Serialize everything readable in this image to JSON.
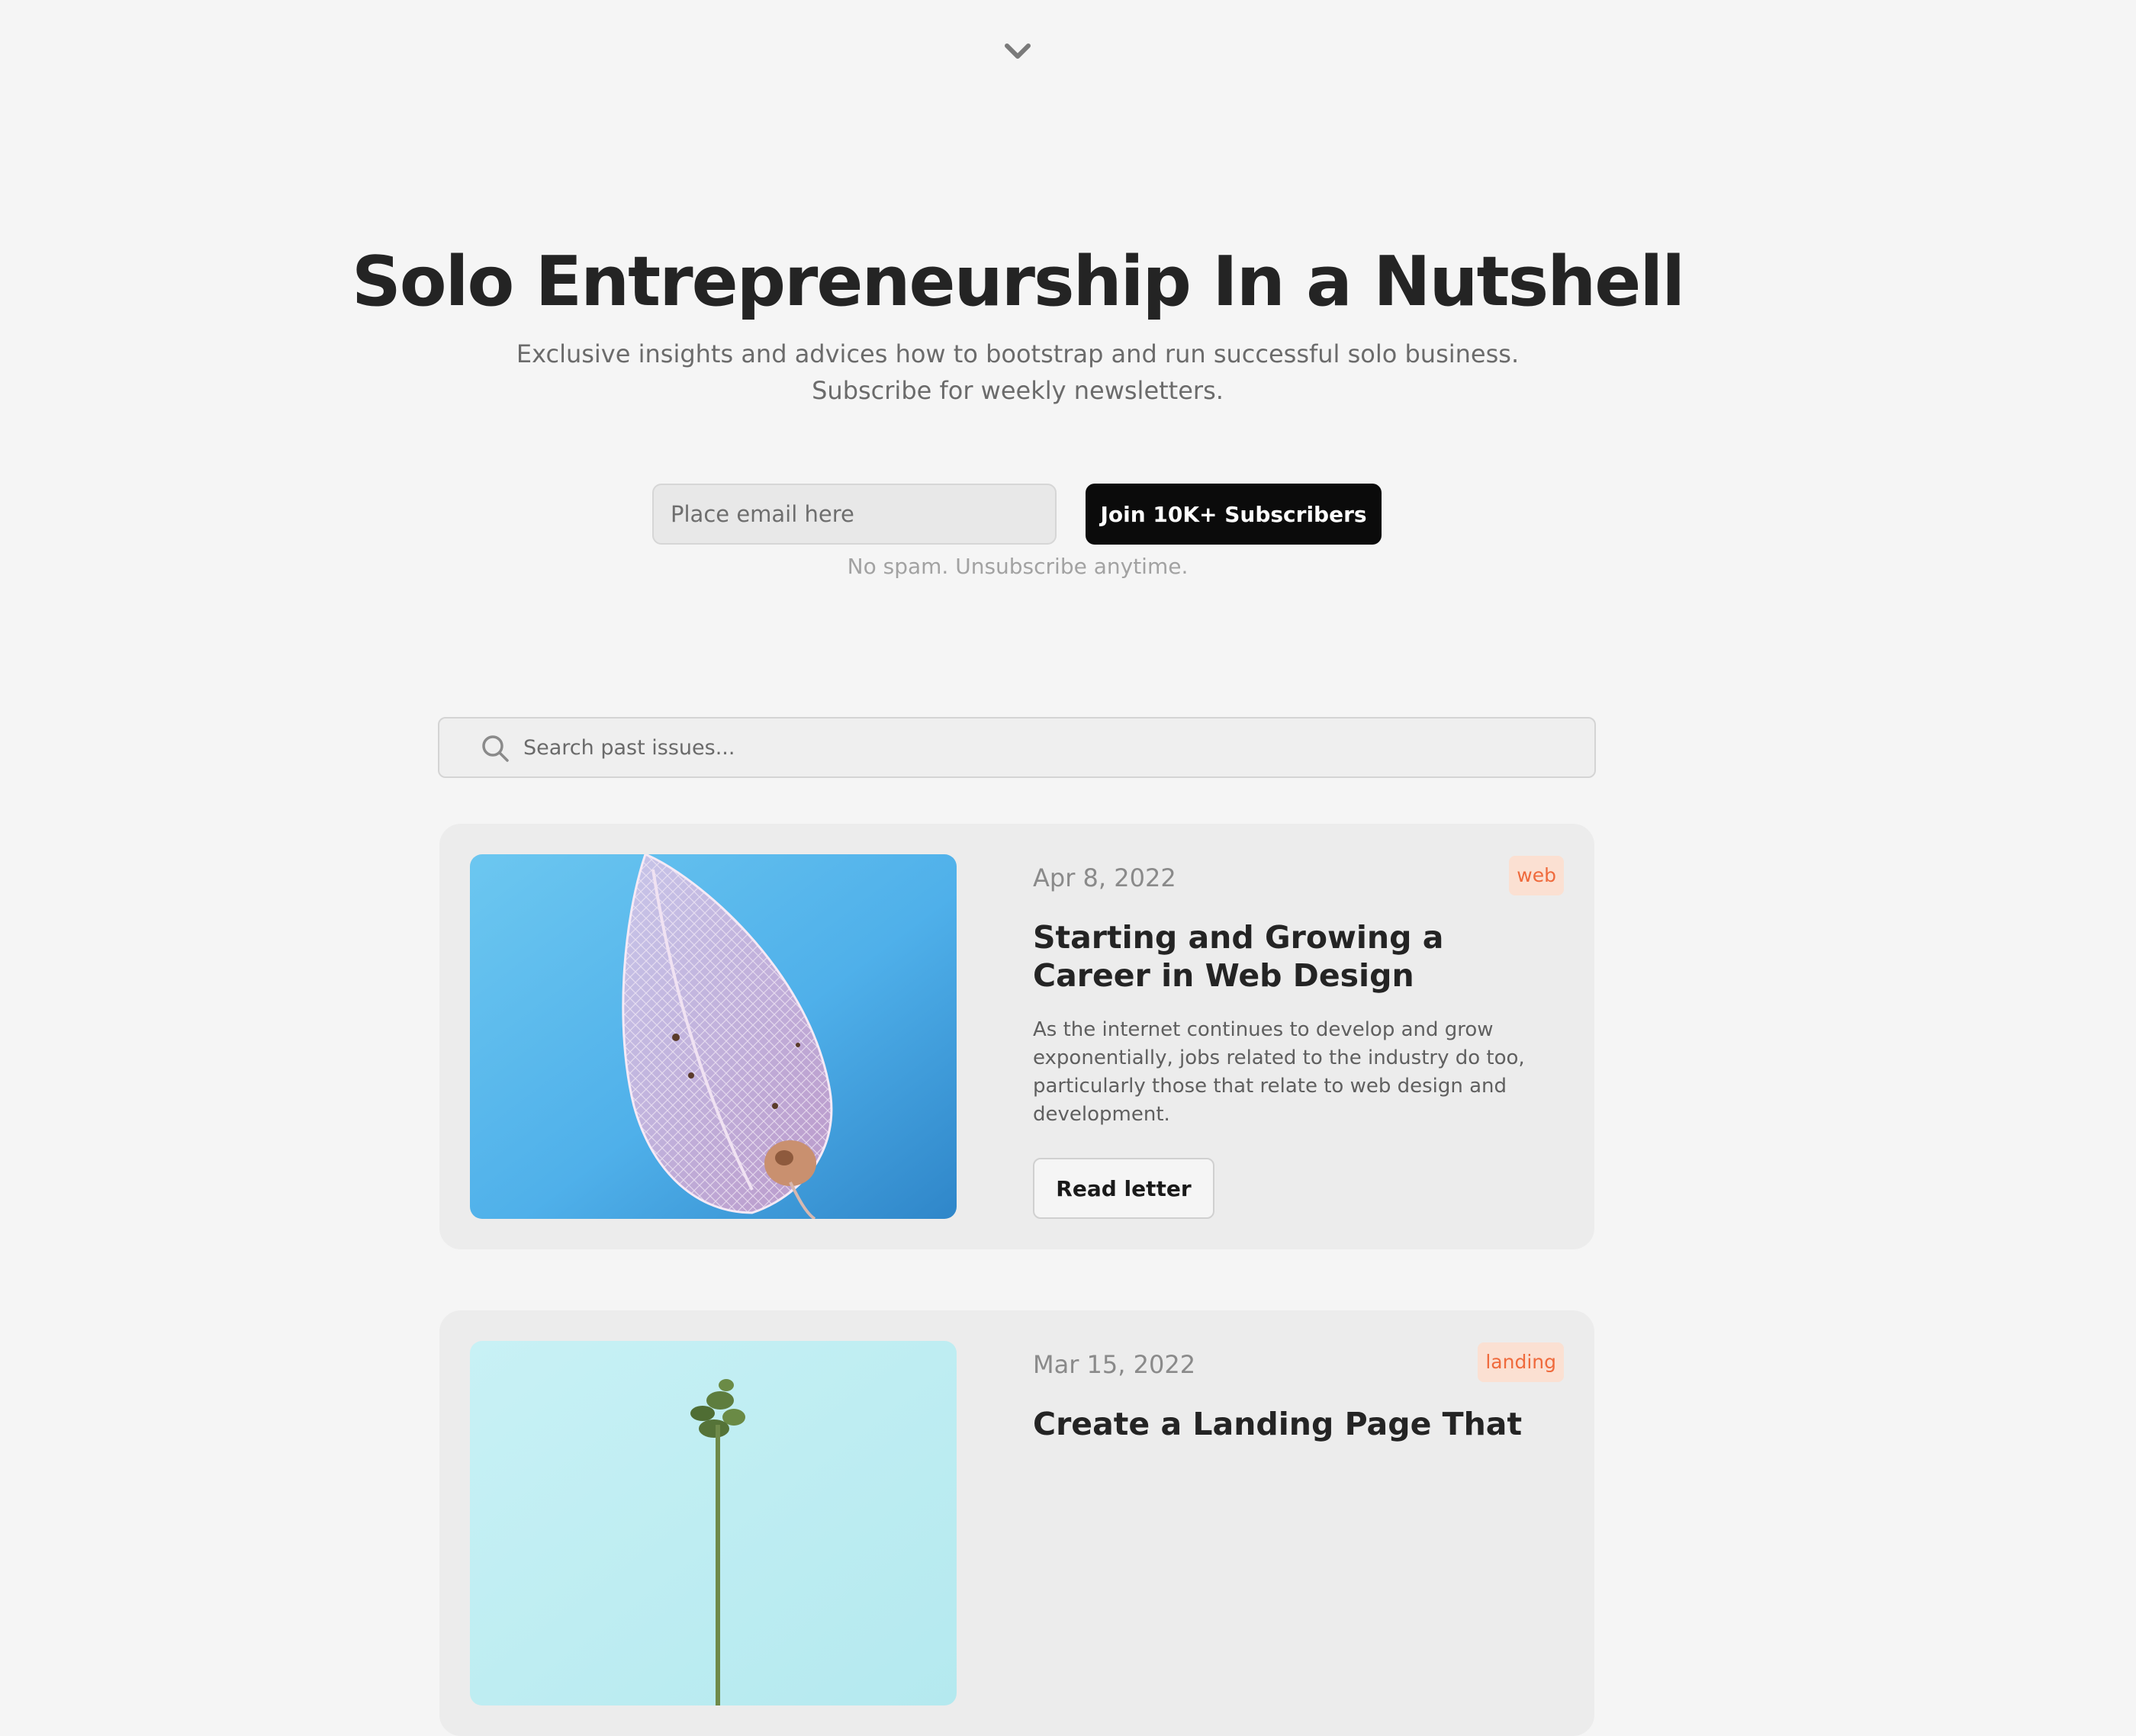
{
  "hero": {
    "title": "Solo Entrepreneurship In a Nutshell",
    "subtitle_line1": "Exclusive insights and advices how to bootstrap and run successful solo business.",
    "subtitle_line2": "Subscribe for weekly newsletters."
  },
  "subscribe": {
    "email_placeholder": "Place email here",
    "email_value": "",
    "button_label": "Join 10K+ Subscribers",
    "note": "No spam. Unsubscribe anytime."
  },
  "search": {
    "placeholder": "Search past issues...",
    "value": ""
  },
  "posts": [
    {
      "date": "Apr 8, 2022",
      "tag": "web",
      "title": "Starting and Growing a Career in Web Design",
      "excerpt": "As the internet continues to develop and grow exponentially, jobs related to the industry do too, particularly those that relate to web design and development.",
      "button_label": "Read letter"
    },
    {
      "date": "Mar 15, 2022",
      "tag": "landing",
      "title": "Create a Landing Page That"
    }
  ],
  "icons": {
    "top": "chevron-down-icon",
    "search": "search-icon"
  },
  "colors": {
    "page_bg": "#f5f5f5",
    "card_bg": "#ececec",
    "primary_button": "#0b0b0b",
    "tag_bg": "#fbe0d2",
    "tag_text": "#ef6a3c"
  }
}
